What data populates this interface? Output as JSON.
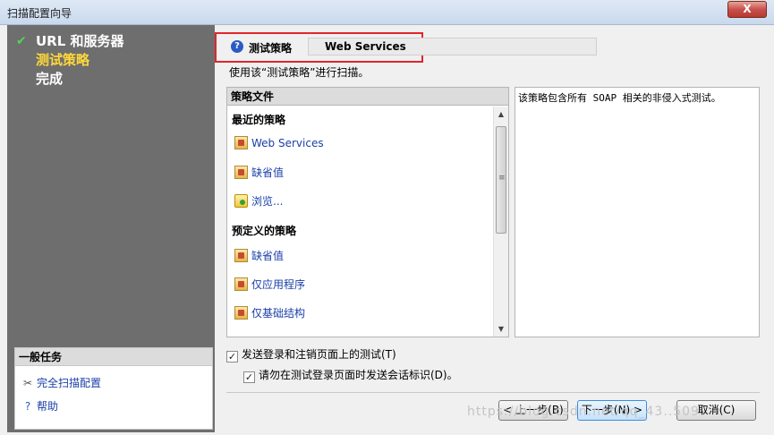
{
  "window": {
    "title": "扫描配置向导",
    "close_label": "X"
  },
  "steps": [
    {
      "label": "URL 和服务器",
      "state": "done"
    },
    {
      "label": "测试策略",
      "state": "current"
    },
    {
      "label": "完成",
      "state": "pending"
    }
  ],
  "tasks": {
    "header": "一般任务",
    "items": [
      {
        "label": "完全扫描配置",
        "icon": "tools-icon"
      },
      {
        "label": "帮助",
        "icon": "help-icon"
      }
    ]
  },
  "policy": {
    "label": "测试策略",
    "value": "Web Services"
  },
  "hint": "使用该“测试策略”进行扫描。",
  "files": {
    "header": "策略文件",
    "recent_title": "最近的策略",
    "recent": [
      "Web Services",
      "缺省值",
      "浏览..."
    ],
    "predefined_title": "预定义的策略",
    "predefined": [
      "缺省值",
      "仅应用程序",
      "仅基础结构"
    ]
  },
  "description": "该策略包含所有 SOAP 相关的非侵入式测试。",
  "options": [
    {
      "label": "发送登录和注销页面上的测试(T)",
      "checked": true
    },
    {
      "label": "请勿在测试登录页面时发送会话标识(D)。",
      "checked": true
    }
  ],
  "buttons": {
    "back": "< 上一步(B)",
    "next": "下一步(N) >",
    "cancel": "取消(C)"
  },
  "watermark": "https://blog.csdn.net/qq_43..509"
}
